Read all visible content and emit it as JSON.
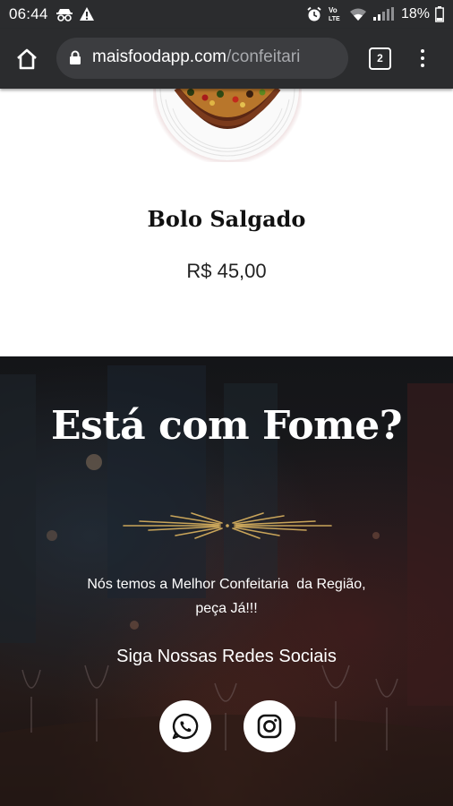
{
  "status_bar": {
    "time": "06:44",
    "battery": "18%",
    "left_icons": [
      "incognito-icon",
      "warning-icon"
    ],
    "right_icons": [
      "alarm-icon",
      "volte-icon",
      "wifi-icon",
      "signal-icon",
      "battery-icon"
    ],
    "volte_label": "Vo LTE"
  },
  "browser": {
    "url_host": "maisfoodapp.com",
    "url_path": "/confeitari",
    "tab_count": "2"
  },
  "product": {
    "name": "Bolo Salgado",
    "price": "R$ 45,00"
  },
  "hero": {
    "title": "Está com Fome?",
    "description_line1": "Nós temos a Melhor Confeitaria  da Região,",
    "description_line2": "peça Já!!!",
    "social_title": "Siga Nossas Redes Sociais"
  },
  "colors": {
    "browser_bg": "#2b2c2e",
    "ornament_gold": "#c9a55a"
  }
}
